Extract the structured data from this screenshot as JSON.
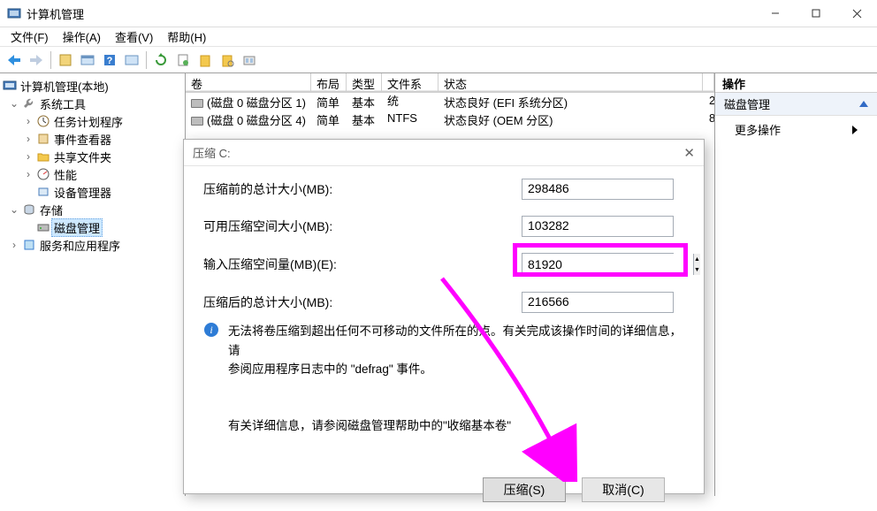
{
  "window": {
    "title": "计算机管理"
  },
  "menu": {
    "file": "文件(F)",
    "action": "操作(A)",
    "view": "查看(V)",
    "help": "帮助(H)"
  },
  "tree": {
    "root": "计算机管理(本地)",
    "systools": "系统工具",
    "task": "任务计划程序",
    "event": "事件查看器",
    "shared": "共享文件夹",
    "perf": "性能",
    "devmgr": "设备管理器",
    "storage": "存储",
    "diskmgmt": "磁盘管理",
    "services": "服务和应用程序"
  },
  "table": {
    "headers": {
      "volume": "卷",
      "layout": "布局",
      "type": "类型",
      "fs": "文件系统",
      "status": "状态"
    },
    "rows": [
      {
        "vol": "(磁盘 0 磁盘分区 1)",
        "layout": "简单",
        "type": "基本",
        "fs": "",
        "status": "状态良好 (EFI 系统分区)",
        "end": "2"
      },
      {
        "vol": "(磁盘 0 磁盘分区 4)",
        "layout": "简单",
        "type": "基本",
        "fs": "NTFS",
        "status": "状态良好 (OEM 分区)",
        "end": "8"
      }
    ]
  },
  "actions": {
    "header": "操作",
    "diskmgmt": "磁盘管理",
    "more": "更多操作"
  },
  "dialog": {
    "title": "压缩 C:",
    "before_label": "压缩前的总计大小(MB):",
    "before_value": "298486",
    "avail_label": "可用压缩空间大小(MB):",
    "avail_value": "103282",
    "input_label": "输入压缩空间量(MB)(E):",
    "input_value": "81920",
    "after_label": "压缩后的总计大小(MB):",
    "after_value": "216566",
    "info1a": "无法将卷压缩到超出任何不可移动的文件所在的点。有关完成该操作时间的详细信息，请",
    "info1b": "参阅应用程序日志中的 \"defrag\" 事件。",
    "info2": "有关详细信息，请参阅磁盘管理帮助中的\"收缩基本卷\"",
    "shrink_btn": "压缩(S)",
    "cancel_btn": "取消(C)"
  }
}
